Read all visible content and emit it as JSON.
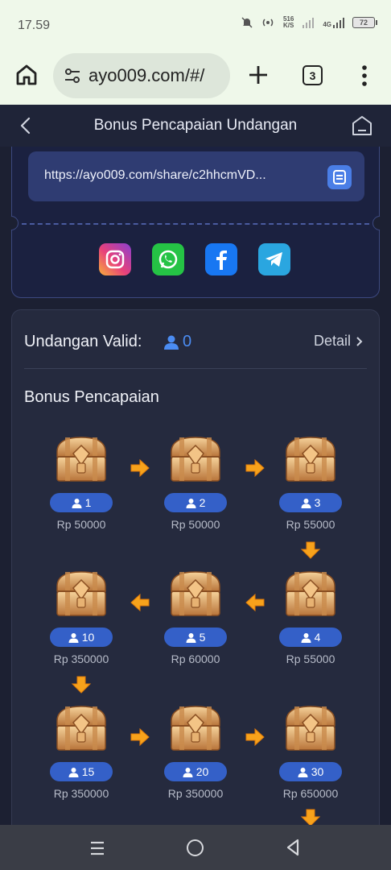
{
  "status": {
    "time": "17.59",
    "speed_top": "516",
    "speed_bottom": "K/S",
    "network": "4G",
    "battery": "72"
  },
  "browser": {
    "url": "ayo009.com/#/",
    "tab_count": "3"
  },
  "header": {
    "title": "Bonus Pencapaian Undangan"
  },
  "share": {
    "link": "https://ayo009.com/share/c2hhcmVD...",
    "socials": [
      "instagram-icon",
      "whatsapp-icon",
      "facebook-icon",
      "telegram-icon"
    ]
  },
  "invites": {
    "label": "Undangan Valid:",
    "count": "0",
    "detail_label": "Detail"
  },
  "bonus": {
    "title": "Bonus Pencapaian",
    "tiers": [
      {
        "count": "1",
        "amount": "Rp 50000"
      },
      {
        "count": "2",
        "amount": "Rp 50000"
      },
      {
        "count": "3",
        "amount": "Rp 55000"
      },
      {
        "count": "10",
        "amount": "Rp 350000"
      },
      {
        "count": "5",
        "amount": "Rp 60000"
      },
      {
        "count": "4",
        "amount": "Rp 55000"
      },
      {
        "count": "15",
        "amount": "Rp 350000"
      },
      {
        "count": "20",
        "amount": "Rp 350000"
      },
      {
        "count": "30",
        "amount": "Rp 650000"
      }
    ]
  },
  "colors": {
    "accent": "#3460c8",
    "background": "#1c2032",
    "arrow": "#f7a21b"
  }
}
